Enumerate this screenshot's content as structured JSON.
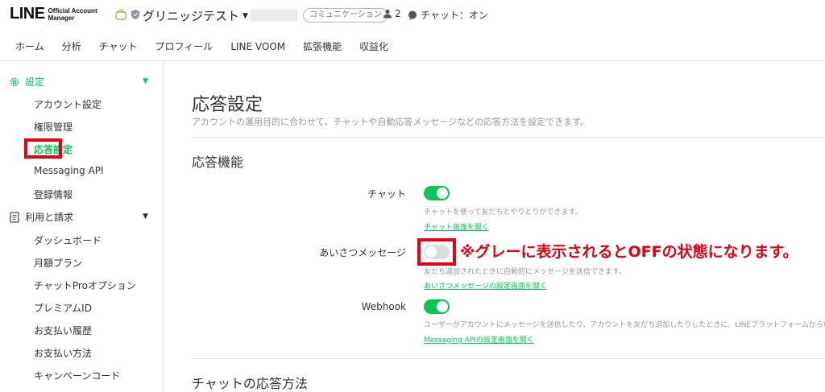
{
  "header": {
    "logo_text": "LINE",
    "logo_sub_1": "Official Account",
    "logo_sub_2": "Manager",
    "account_name": "グリニッジテスト",
    "community_badge": "コミュニケーション",
    "member_count": "2",
    "chat_status": "チャット：オン"
  },
  "tabs": [
    "ホーム",
    "分析",
    "チャット",
    "プロフィール",
    "LINE VOOM",
    "拡張機能",
    "収益化"
  ],
  "sidebar": {
    "section1": {
      "label": "設定",
      "items": [
        "アカウント設定",
        "権限管理",
        "応答設定",
        "Messaging API",
        "登録情報"
      ]
    },
    "section2": {
      "label": "利用と請求",
      "items": [
        "ダッシュボード",
        "月額プラン",
        "チャットProオプション",
        "プレミアムID",
        "お支払い履歴",
        "お支払い方法",
        "キャンペーンコード"
      ]
    }
  },
  "main": {
    "title": "応答設定",
    "description": "アカウントの運用目的に合わせて、チャットや自動応答メッセージなどの応答方法を設定できます。",
    "section1_title": "応答機能",
    "rows": [
      {
        "label": "チャット",
        "state": "on",
        "desc": "チャットを使って友だちとやりとりができます。",
        "link": "チャット画面を開く"
      },
      {
        "label": "あいさつメッセージ",
        "state": "off",
        "desc": "友だち追加されたときに自動的にメッセージを送信できます。",
        "link": "あいさつメッセージの設定画面を開く"
      },
      {
        "label": "Webhook",
        "state": "on",
        "desc": "ユーザーがアカウントにメッセージを送信したり、アカウントを友だち追加したりしたときに、LINEプラットフォームからWeb",
        "link": "Messaging APIの設定画面を開く"
      }
    ],
    "section2_title": "チャットの応答方法",
    "annotation": "※グレーに表示されるとOFFの状態になります。"
  },
  "colors": {
    "accent": "#06c755",
    "annotation_red": "#e60012",
    "toggle_off": "#dddddd"
  }
}
